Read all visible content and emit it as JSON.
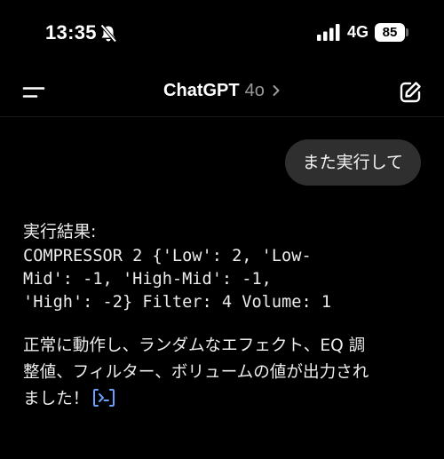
{
  "status_bar": {
    "time": "13:35",
    "network": "4G",
    "battery": "85"
  },
  "header": {
    "title": "ChatGPT",
    "model": "4o"
  },
  "conversation": {
    "user_message": "また実行して",
    "assistant": {
      "result_label": "実行結果:",
      "code_lines": [
        "COMPRESSOR 2 {'Low': 2, 'Low-",
        "Mid': -1, 'High-Mid': -1,",
        "'High': -2} Filter: 4 Volume: 1"
      ],
      "summary_lines": [
        "正常に動作し、ランダムなエフェクト、EQ 調",
        "整値、フィルター、ボリュームの値が出力され",
        "ました！"
      ]
    }
  },
  "icons": {
    "status": [
      "bell-slash-icon",
      "signal-icon"
    ],
    "header": [
      "menu-icon",
      "chevron-right-icon",
      "edit-icon"
    ],
    "message": [
      "code-action-icon"
    ]
  },
  "colors": {
    "background": "#000000",
    "user_bubble": "#2f2f2f",
    "model_label": "#9a9a9a",
    "code_icon": "#6aa0ff"
  }
}
